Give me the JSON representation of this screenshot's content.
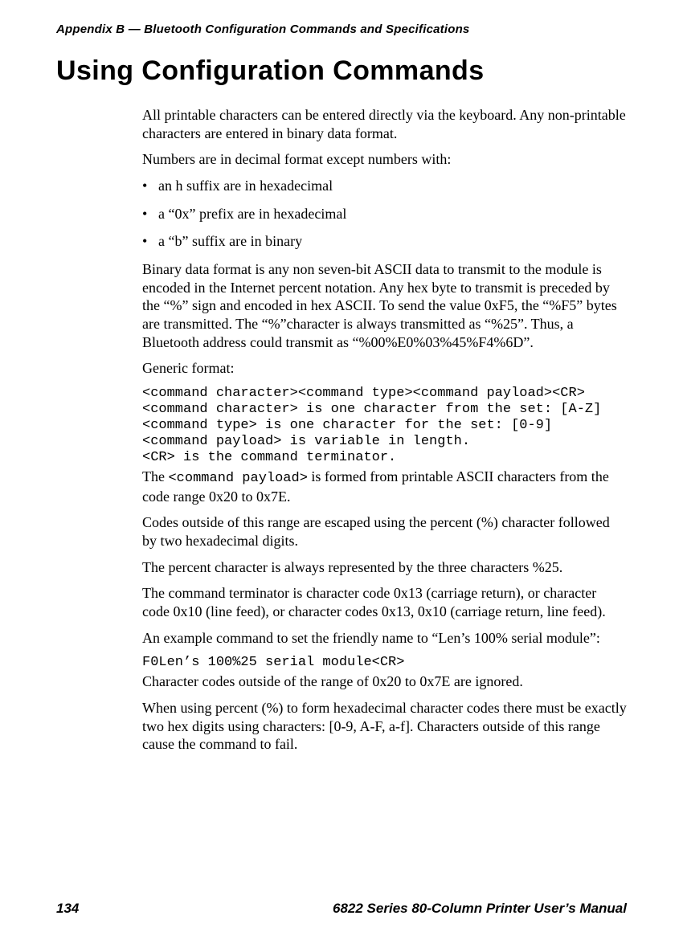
{
  "runningHead": "Appendix B — Bluetooth Configuration Commands and Specifications",
  "title": "Using Configuration Commands",
  "p1": "All printable characters can be entered directly via the keyboard. Any non-printable characters are entered in binary data format.",
  "p2": "Numbers are in decimal format except numbers with:",
  "bullets": {
    "b1": "an h suffix are in hexadecimal",
    "b2": "a “0x” prefix are in hexadecimal",
    "b3": "a “b” suffix are in binary"
  },
  "p3": "Binary data format is any non seven-bit ASCII data to transmit to the module is encoded in the Internet percent notation. Any hex byte to transmit is preceded by the “%” sign and encoded in hex ASCII. To send the value 0xF5, the “%F5” bytes are transmitted. The “%”character is always transmitted as “%25”. Thus, a Bluetooth address could transmit as “%00%E0%03%45%F4%6D”.",
  "p4": "Generic format:",
  "code1": "<command character><command type><command payload><CR>\n<command character> is one character from the set: [A-Z]\n<command type> is one character for the set: [0-9]\n<command payload> is variable in length.\n<CR> is the command terminator.",
  "p5a": "The ",
  "p5code": "<command payload>",
  "p5b": " is formed from printable ASCII characters from the code range 0x20 to 0x7E.",
  "p6": "Codes outside of this range are escaped using the percent (%) character followed by two hexadecimal digits.",
  "p7": "The percent character is always represented by the three characters %25.",
  "p8": "The command terminator is character code 0x13 (carriage return), or character code 0x10 (line feed), or character codes 0x13, 0x10 (carriage return, line feed).",
  "p9": "An example command to set the friendly name to “Len’s 100% serial module”:",
  "code2": "F0Len’s 100%25 serial module<CR>",
  "p10": "Character codes outside of the range of 0x20 to 0x7E are ignored.",
  "p11": "When using percent (%) to form hexadecimal character codes there must be exactly two hex digits using characters: [0-9, A-F, a-f]. Characters outside of this range cause the command to fail.",
  "footer": {
    "pageNum": "134",
    "bookTitle": "6822 Series 80-Column Printer User’s Manual"
  }
}
